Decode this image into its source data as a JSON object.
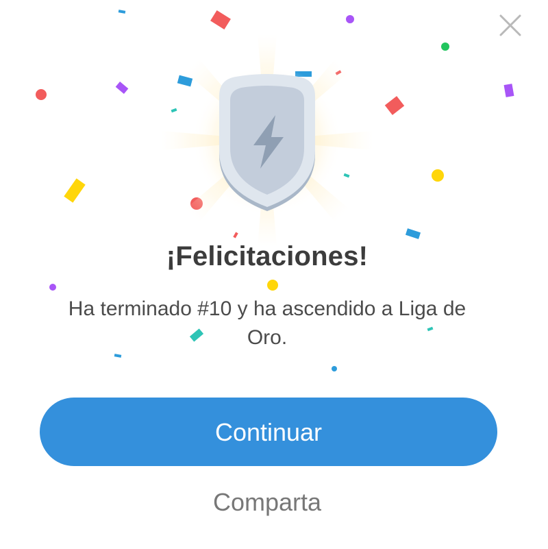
{
  "dialog": {
    "title": "¡Felicitaciones!",
    "message": "Ha terminado #10 y ha ascendido a Liga de Oro.",
    "continue_label": "Continuar",
    "share_label": "Comparta",
    "close_icon": "close-icon",
    "badge_icon": "lightning-shield-icon"
  },
  "colors": {
    "primary_button": "#3490dc",
    "title_text": "#3c3c3c",
    "body_text": "#4b4b4b",
    "share_text": "#777777",
    "shield_fill": "#c9d3df",
    "confetti": [
      "#f25c5c",
      "#a855f7",
      "#2d9cdb",
      "#ffd60a",
      "#2ec4b6",
      "#22c55e"
    ]
  }
}
